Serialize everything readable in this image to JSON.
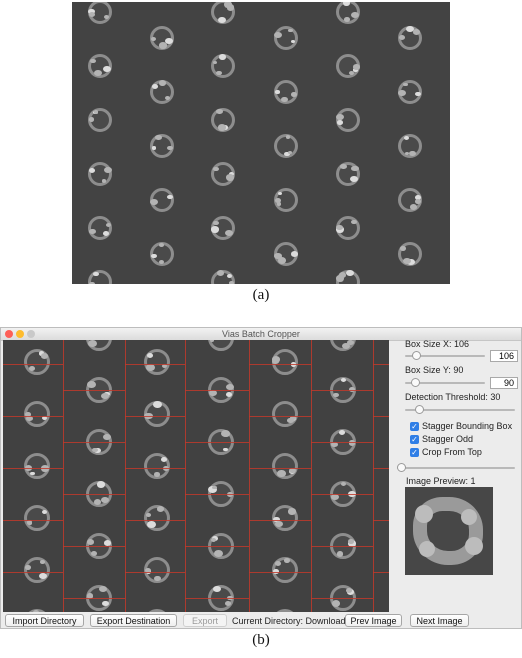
{
  "figure": {
    "caption_a": "(a)",
    "caption_b": "(b)"
  },
  "window": {
    "title": "Vias Batch Cropper"
  },
  "controls": {
    "box_size_x": {
      "label": "Box Size X: 106",
      "value": "106",
      "level": 0.1
    },
    "box_size_y": {
      "label": "Box Size Y: 90",
      "value": "90",
      "level": 0.08
    },
    "detection_threshold": {
      "label": "Detection Threshold: 30",
      "level": 0.1
    },
    "checkboxes": [
      {
        "label": "Stagger Bounding Box",
        "checked": true
      },
      {
        "label": "Stagger Odd",
        "checked": true
      },
      {
        "label": "Crop From Top",
        "checked": true
      }
    ],
    "image_slider_level": 0.0,
    "image_preview_label": "Image Preview: 1"
  },
  "bottom_bar": {
    "import_directory": "Import Directory",
    "export_destination": "Export Destination",
    "export": "Export",
    "current_directory": "Current Directory: Downloads",
    "prev_image": "Prev Image",
    "next_image": "Next Image"
  },
  "colors": {
    "micrograph_bg": "#434343",
    "grid_line": "#c0392b",
    "checkbox_blue": "#2f7ee6"
  }
}
